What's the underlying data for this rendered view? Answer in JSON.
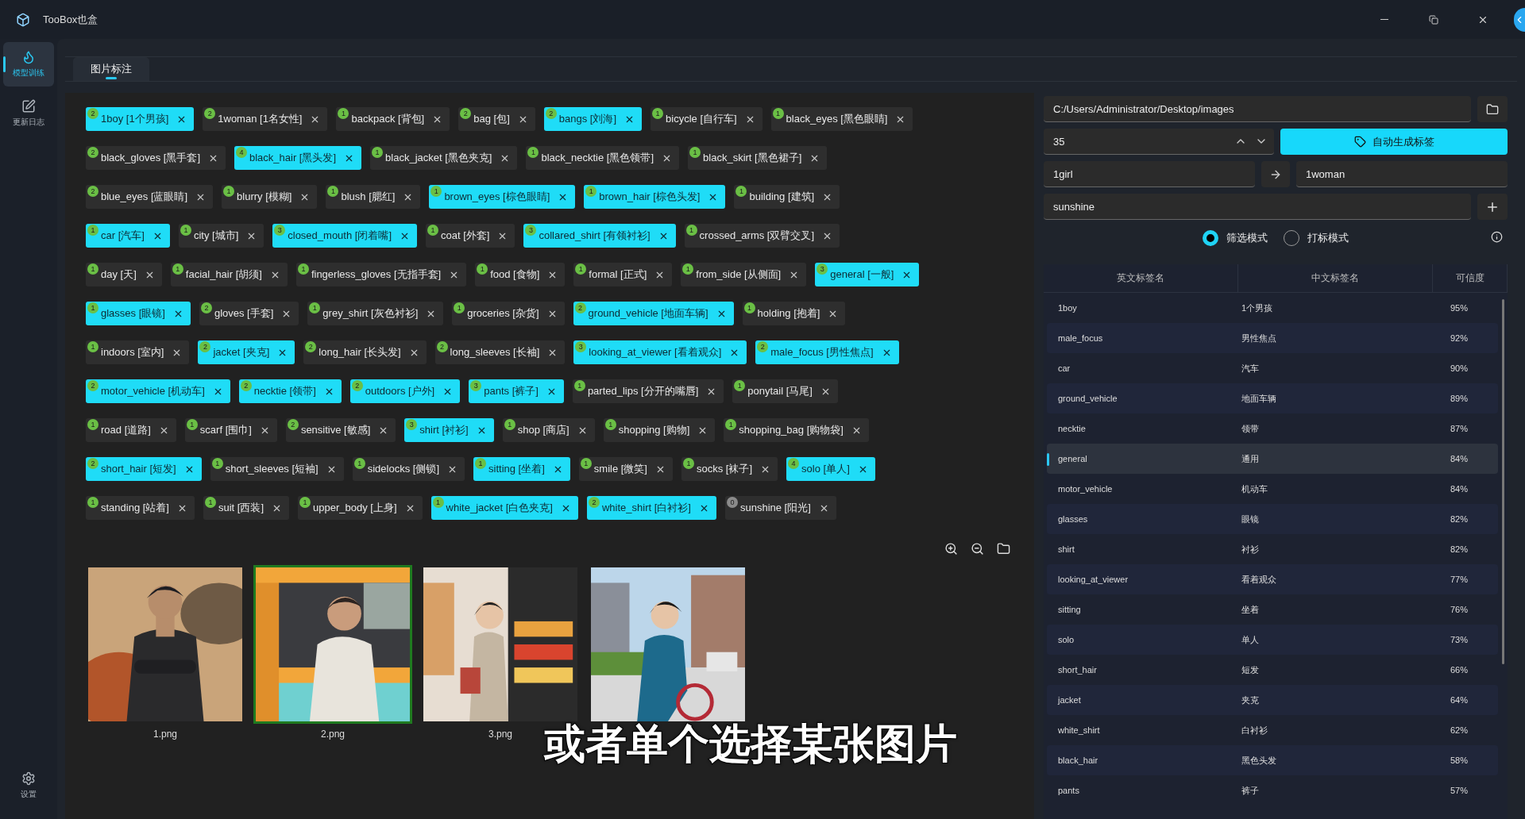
{
  "app": {
    "title": "TooBox也盒"
  },
  "sidebar": {
    "items": [
      {
        "label": "模型训练",
        "selected": true
      },
      {
        "label": "更新日志",
        "selected": false
      }
    ],
    "footer": {
      "label": "设置"
    }
  },
  "tabs": [
    {
      "label": "图片标注",
      "selected": true
    }
  ],
  "tag_rows": [
    [
      {
        "count": "2",
        "name": "1boy [1个男孩]",
        "selected": true,
        "color": "#6abf45"
      },
      {
        "count": "2",
        "name": "1woman [1名女性]",
        "selected": false,
        "color": "#6abf45"
      },
      {
        "count": "1",
        "name": "backpack [背包]",
        "selected": false,
        "color": "#6abf45"
      },
      {
        "count": "2",
        "name": "bag [包]",
        "selected": false,
        "color": "#6abf45"
      },
      {
        "count": "2",
        "name": "bangs [刘海]",
        "selected": true,
        "color": "#6abf45"
      },
      {
        "count": "1",
        "name": "bicycle [自行车]",
        "selected": false,
        "color": "#6abf45"
      },
      {
        "count": "1",
        "name": "black_eyes [黑色眼睛]",
        "selected": false,
        "color": "#6abf45"
      }
    ],
    [
      {
        "count": "2",
        "name": "black_gloves [黑手套]",
        "selected": false,
        "color": "#6abf45"
      },
      {
        "count": "4",
        "name": "black_hair [黑头发]",
        "selected": true,
        "color": "#6abf45"
      },
      {
        "count": "1",
        "name": "black_jacket [黑色夹克]",
        "selected": false,
        "color": "#6abf45"
      },
      {
        "count": "1",
        "name": "black_necktie [黑色领带]",
        "selected": false,
        "color": "#6abf45"
      },
      {
        "count": "1",
        "name": "black_skirt [黑色裙子]",
        "selected": false,
        "color": "#6abf45"
      }
    ],
    [
      {
        "count": "2",
        "name": "blue_eyes [蓝眼睛]",
        "selected": false,
        "color": "#6abf45"
      },
      {
        "count": "1",
        "name": "blurry [模糊]",
        "selected": false,
        "color": "#6abf45"
      },
      {
        "count": "1",
        "name": "blush [腮红]",
        "selected": false,
        "color": "#6abf45"
      },
      {
        "count": "1",
        "name": "brown_eyes [棕色眼睛]",
        "selected": true,
        "color": "#6abf45"
      },
      {
        "count": "1",
        "name": "brown_hair [棕色头发]",
        "selected": true,
        "color": "#6abf45"
      },
      {
        "count": "1",
        "name": "building [建筑]",
        "selected": false,
        "color": "#6abf45"
      }
    ],
    [
      {
        "count": "1",
        "name": "car [汽车]",
        "selected": true,
        "color": "#6abf45"
      },
      {
        "count": "1",
        "name": "city [城市]",
        "selected": false,
        "color": "#6abf45"
      },
      {
        "count": "3",
        "name": "closed_mouth [闭着嘴]",
        "selected": true,
        "color": "#6abf45"
      },
      {
        "count": "1",
        "name": "coat [外套]",
        "selected": false,
        "color": "#6abf45"
      },
      {
        "count": "3",
        "name": "collared_shirt [有领衬衫]",
        "selected": true,
        "color": "#6abf45"
      },
      {
        "count": "1",
        "name": "crossed_arms [双臂交叉]",
        "selected": false,
        "color": "#6abf45"
      }
    ],
    [
      {
        "count": "1",
        "name": "day [天]",
        "selected": false,
        "color": "#6abf45"
      },
      {
        "count": "1",
        "name": "facial_hair [胡须]",
        "selected": false,
        "color": "#6abf45"
      },
      {
        "count": "1",
        "name": "fingerless_gloves [无指手套]",
        "selected": false,
        "color": "#6abf45"
      },
      {
        "count": "1",
        "name": "food [食物]",
        "selected": false,
        "color": "#6abf45"
      },
      {
        "count": "1",
        "name": "formal [正式]",
        "selected": false,
        "color": "#6abf45"
      },
      {
        "count": "1",
        "name": "from_side [从侧面]",
        "selected": false,
        "color": "#6abf45"
      },
      {
        "count": "3",
        "name": "general [一般]",
        "selected": true,
        "color": "#6abf45"
      }
    ],
    [
      {
        "count": "1",
        "name": "glasses [眼镜]",
        "selected": true,
        "color": "#6abf45"
      },
      {
        "count": "2",
        "name": "gloves [手套]",
        "selected": false,
        "color": "#6abf45"
      },
      {
        "count": "1",
        "name": "grey_shirt [灰色衬衫]",
        "selected": false,
        "color": "#6abf45"
      },
      {
        "count": "1",
        "name": "groceries [杂货]",
        "selected": false,
        "color": "#6abf45"
      },
      {
        "count": "2",
        "name": "ground_vehicle [地面车辆]",
        "selected": true,
        "color": "#6abf45"
      },
      {
        "count": "1",
        "name": "holding [抱着]",
        "selected": false,
        "color": "#6abf45"
      }
    ],
    [
      {
        "count": "1",
        "name": "indoors [室内]",
        "selected": false,
        "color": "#6abf45"
      },
      {
        "count": "2",
        "name": "jacket [夹克]",
        "selected": true,
        "color": "#6abf45"
      },
      {
        "count": "2",
        "name": "long_hair [长头发]",
        "selected": false,
        "color": "#6abf45"
      },
      {
        "count": "2",
        "name": "long_sleeves [长袖]",
        "selected": false,
        "color": "#6abf45"
      },
      {
        "count": "3",
        "name": "looking_at_viewer [看着观众]",
        "selected": true,
        "color": "#6abf45"
      },
      {
        "count": "2",
        "name": "male_focus [男性焦点]",
        "selected": true,
        "color": "#6abf45"
      }
    ],
    [
      {
        "count": "2",
        "name": "motor_vehicle [机动车]",
        "selected": true,
        "color": "#6abf45"
      },
      {
        "count": "2",
        "name": "necktie [领带]",
        "selected": true,
        "color": "#6abf45"
      },
      {
        "count": "2",
        "name": "outdoors [户外]",
        "selected": true,
        "color": "#6abf45"
      },
      {
        "count": "3",
        "name": "pants [裤子]",
        "selected": true,
        "color": "#6abf45"
      },
      {
        "count": "1",
        "name": "parted_lips [分开的嘴唇]",
        "selected": false,
        "color": "#6abf45"
      },
      {
        "count": "1",
        "name": "ponytail [马尾]",
        "selected": false,
        "color": "#6abf45"
      }
    ],
    [
      {
        "count": "1",
        "name": "road [道路]",
        "selected": false,
        "color": "#6abf45"
      },
      {
        "count": "1",
        "name": "scarf [围巾]",
        "selected": false,
        "color": "#6abf45"
      },
      {
        "count": "2",
        "name": "sensitive [敏感]",
        "selected": false,
        "color": "#6abf45"
      },
      {
        "count": "3",
        "name": "shirt [衬衫]",
        "selected": true,
        "color": "#6abf45"
      },
      {
        "count": "1",
        "name": "shop [商店]",
        "selected": false,
        "color": "#6abf45"
      },
      {
        "count": "1",
        "name": "shopping [购物]",
        "selected": false,
        "color": "#6abf45"
      },
      {
        "count": "1",
        "name": "shopping_bag [购物袋]",
        "selected": false,
        "color": "#6abf45"
      }
    ],
    [
      {
        "count": "2",
        "name": "short_hair [短发]",
        "selected": true,
        "color": "#6abf45"
      },
      {
        "count": "1",
        "name": "short_sleeves [短袖]",
        "selected": false,
        "color": "#6abf45"
      },
      {
        "count": "1",
        "name": "sidelocks [侧锁]",
        "selected": false,
        "color": "#6abf45"
      },
      {
        "count": "1",
        "name": "sitting [坐着]",
        "selected": true,
        "color": "#6abf45"
      },
      {
        "count": "1",
        "name": "smile [微笑]",
        "selected": false,
        "color": "#6abf45"
      },
      {
        "count": "1",
        "name": "socks [袜子]",
        "selected": false,
        "color": "#6abf45"
      },
      {
        "count": "4",
        "name": "solo [单人]",
        "selected": true,
        "color": "#6abf45"
      }
    ],
    [
      {
        "count": "1",
        "name": "standing [站着]",
        "selected": false,
        "color": "#6abf45"
      },
      {
        "count": "1",
        "name": "suit [西装]",
        "selected": false,
        "color": "#6abf45"
      },
      {
        "count": "1",
        "name": "upper_body [上身]",
        "selected": false,
        "color": "#6abf45"
      },
      {
        "count": "1",
        "name": "white_jacket [白色夹克]",
        "selected": true,
        "color": "#6abf45"
      },
      {
        "count": "2",
        "name": "white_shirt [白衬衫]",
        "selected": true,
        "color": "#6abf45"
      },
      {
        "count": "0",
        "name": "sunshine [阳光]",
        "selected": false,
        "color": "#8a8a8a"
      }
    ]
  ],
  "images": [
    {
      "kind": "picture",
      "filename": "1.png",
      "selected": false
    },
    {
      "kind": "picture",
      "filename": "2.png",
      "selected": true
    },
    {
      "kind": "picture",
      "filename": "3.png",
      "selected": false
    },
    {
      "kind": "picture",
      "selected": false
    }
  ],
  "right_panel": {
    "folder_path": "C:/Users/Administrator/Desktop/images",
    "threshold": "35",
    "auto_tag_button": "自动生成标签",
    "replace_from": "1girl",
    "replace_to": "1woman",
    "add_tag": "sunshine",
    "modes": [
      {
        "label": "筛选模式",
        "selected": true
      },
      {
        "label": "打标模式",
        "selected": false
      }
    ]
  },
  "table": {
    "columns": [
      "英文标签名",
      "中文标签名",
      "可信度"
    ],
    "rows": [
      {
        "english": "1boy",
        "chinese": "1个男孩",
        "confidence": "95%",
        "selected": false
      },
      {
        "english": "male_focus",
        "chinese": "男性焦点",
        "confidence": "92%",
        "selected": false
      },
      {
        "english": "car",
        "chinese": "汽车",
        "confidence": "90%",
        "selected": false
      },
      {
        "english": "ground_vehicle",
        "chinese": "地面车辆",
        "confidence": "89%",
        "selected": false
      },
      {
        "english": "necktie",
        "chinese": "领带",
        "confidence": "87%",
        "selected": false
      },
      {
        "english": "general",
        "chinese": "通用",
        "confidence": "84%",
        "selected": true
      },
      {
        "english": "motor_vehicle",
        "chinese": "机动车",
        "confidence": "84%",
        "selected": false
      },
      {
        "english": "glasses",
        "chinese": "眼镜",
        "confidence": "82%",
        "selected": false
      },
      {
        "english": "shirt",
        "chinese": "衬衫",
        "confidence": "82%",
        "selected": false
      },
      {
        "english": "looking_at_viewer",
        "chinese": "看着观众",
        "confidence": "77%",
        "selected": false
      },
      {
        "english": "sitting",
        "chinese": "坐着",
        "confidence": "76%",
        "selected": false
      },
      {
        "english": "solo",
        "chinese": "单人",
        "confidence": "73%",
        "selected": false
      },
      {
        "english": "short_hair",
        "chinese": "短发",
        "confidence": "66%",
        "selected": false
      },
      {
        "english": "jacket",
        "chinese": "夹克",
        "confidence": "64%",
        "selected": false
      },
      {
        "english": "white_shirt",
        "chinese": "白衬衫",
        "confidence": "62%",
        "selected": false
      },
      {
        "english": "black_hair",
        "chinese": "黑色头发",
        "confidence": "58%",
        "selected": false
      },
      {
        "english": "pants",
        "chinese": "裤子",
        "confidence": "57%",
        "selected": false
      }
    ]
  },
  "caption": "或者单个选择某张图片"
}
